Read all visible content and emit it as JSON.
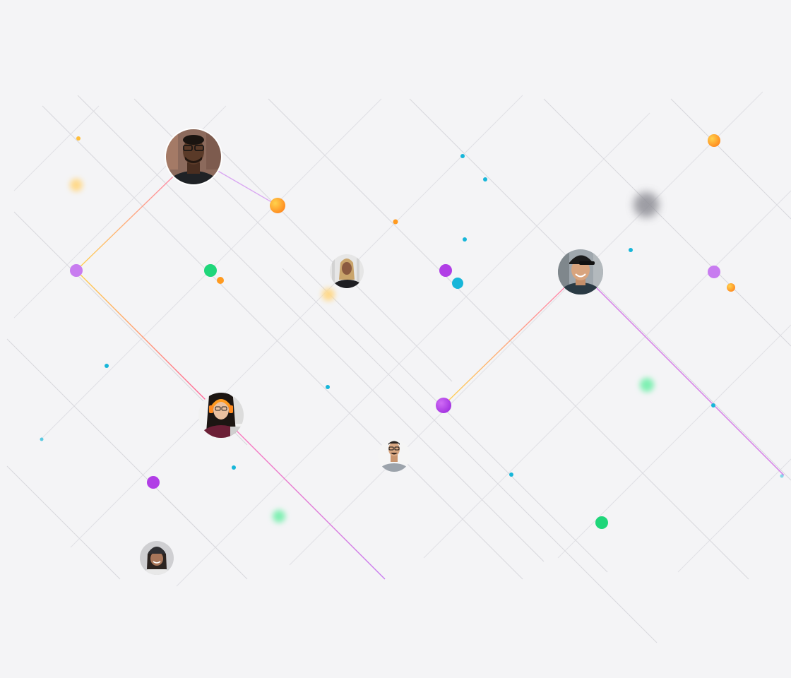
{
  "palette": {
    "background": "#f4f4f6",
    "grid_line": "#c9c9cf",
    "grid_line_light": "#dedee3",
    "purple": "#b13ee6",
    "purple_soft": "#c87cf0",
    "green": "#1fd67a",
    "cyan": "#17b6d9",
    "orange": "#ff9a1f",
    "yellow": "#ffd24d",
    "pink": "#ff5aa5"
  },
  "avatars": [
    {
      "name": "avatar-man-glasses-black-hoodie",
      "skin": "#5a3a28",
      "hair": "#1a1410",
      "shirt": "#1f2226",
      "bg": "#8c6a5c"
    },
    {
      "name": "avatar-woman-braids-white-bg",
      "skin": "#8a5a40",
      "hair": "#c9a46b",
      "shirt": "#1e1e22",
      "bg": "#e6e6e6"
    },
    {
      "name": "avatar-man-black-cap",
      "skin": "#d8a47e",
      "hair": "#1b1b1b",
      "shirt": "#2a3a44",
      "bg": "#9fa7ad"
    },
    {
      "name": "avatar-woman-orange-headphones",
      "skin": "#e9c0a0",
      "hair": "#1c1512",
      "shirt": "#6b1f36",
      "bg": "#f2f2f2"
    },
    {
      "name": "avatar-man-glasses-grey-shirt",
      "skin": "#d9a883",
      "hair": "#2a2420",
      "shirt": "#9ca3ab",
      "bg": "#f5f5f5"
    },
    {
      "name": "avatar-woman-beanie-smiling",
      "skin": "#a8765a",
      "hair": "#2b2320",
      "shirt": "#e8e8e8",
      "bg": "#cfcfd2"
    }
  ],
  "decorative_icons": [
    "network-grid-icon",
    "connection-node-icon",
    "profile-avatar-icon"
  ]
}
